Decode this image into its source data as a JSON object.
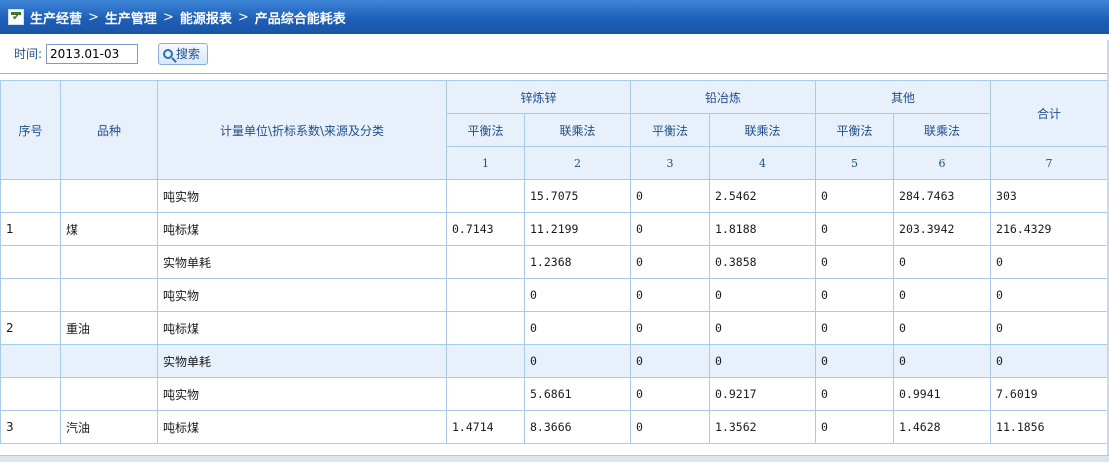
{
  "breadcrumb": {
    "items": [
      "生产经营",
      "生产管理",
      "能源报表",
      "产品综合能耗表"
    ],
    "separator": ">"
  },
  "search": {
    "label": "时间:",
    "date_value": "2013.01-03",
    "button_label": "搜索"
  },
  "table": {
    "headers": {
      "seq": "序号",
      "variety": "品种",
      "unit": "计量单位\\折标系数\\来源及分类",
      "group_zinc": "锌炼锌",
      "group_lead": "铅冶炼",
      "group_other": "其他",
      "total": "合计",
      "balance": "平衡法",
      "chain": "联乘法",
      "col_nums": [
        "1",
        "2",
        "3",
        "4",
        "5",
        "6",
        "7"
      ]
    },
    "rows": [
      {
        "seq": "",
        "variety": "",
        "unit": "吨实物",
        "c1": "",
        "c2": "15.7075",
        "c3": "0",
        "c4": "2.5462",
        "c5": "0",
        "c6": "284.7463",
        "c7": "303"
      },
      {
        "seq": "1",
        "variety": "煤",
        "unit": "吨标煤",
        "c1": "0.7143",
        "c2": "11.2199",
        "c3": "0",
        "c4": "1.8188",
        "c5": "0",
        "c6": "203.3942",
        "c7": "216.4329"
      },
      {
        "seq": "",
        "variety": "",
        "unit": "实物单耗",
        "c1": "",
        "c2": "1.2368",
        "c3": "0",
        "c4": "0.3858",
        "c5": "0",
        "c6": "0",
        "c7": "0"
      },
      {
        "seq": "",
        "variety": "",
        "unit": "吨实物",
        "c1": "",
        "c2": "0",
        "c3": "0",
        "c4": "0",
        "c5": "0",
        "c6": "0",
        "c7": "0"
      },
      {
        "seq": "2",
        "variety": "重油",
        "unit": "吨标煤",
        "c1": "",
        "c2": "0",
        "c3": "0",
        "c4": "0",
        "c5": "0",
        "c6": "0",
        "c7": "0"
      },
      {
        "seq": "",
        "variety": "",
        "unit": "实物单耗",
        "c1": "",
        "c2": "0",
        "c3": "0",
        "c4": "0",
        "c5": "0",
        "c6": "0",
        "c7": "0"
      },
      {
        "seq": "",
        "variety": "",
        "unit": "吨实物",
        "c1": "",
        "c2": "5.6861",
        "c3": "0",
        "c4": "0.9217",
        "c5": "0",
        "c6": "0.9941",
        "c7": "7.6019"
      },
      {
        "seq": "3",
        "variety": "汽油",
        "unit": "吨标煤",
        "c1": "1.4714",
        "c2": "8.3666",
        "c3": "0",
        "c4": "1.3562",
        "c5": "0",
        "c6": "1.4628",
        "c7": "11.1856"
      }
    ]
  },
  "colors": {
    "title_bar": "#1e5fb8",
    "header_bg": "#e8f1fb",
    "grid_line": "#a9cbea",
    "header_text": "#1f4f8f"
  }
}
